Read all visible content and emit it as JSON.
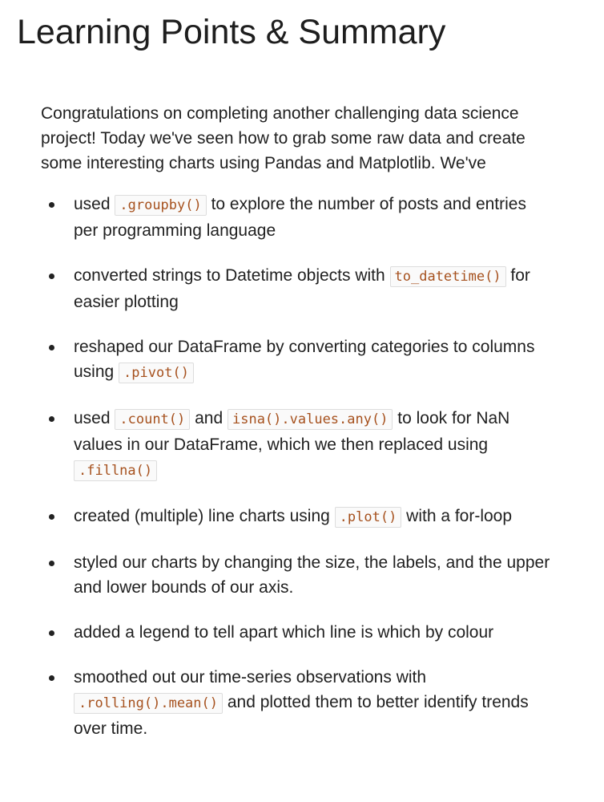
{
  "title": "Learning Points & Summary",
  "intro": "Congratulations on completing another challenging data science project! Today we've seen how to grab some raw data and create some interesting charts using Pandas and Matplotlib. We've",
  "bullets": [
    {
      "before": "used ",
      "code": ".groupby()",
      "after": " to explore the number of posts and entries per programming language"
    },
    {
      "before": "converted strings to Datetime objects with ",
      "code": "to_datetime()",
      "after": " for easier plotting"
    },
    {
      "before": "reshaped our DataFrame by converting categories to columns using ",
      "code": ".pivot()",
      "after": ""
    },
    {
      "before": "used ",
      "code": ".count()",
      "mid": " and ",
      "code2": "isna().values.any()",
      "mid2": " to look for NaN values in our DataFrame, which we then replaced using ",
      "code3": ".fillna()"
    },
    {
      "before": "created (multiple) line charts using ",
      "code": ".plot()",
      "after": " with a for-loop"
    },
    {
      "text": "styled our charts by changing the size, the labels, and the upper and lower bounds of our axis."
    },
    {
      "text": "added a legend to tell apart which line is which by colour"
    },
    {
      "before": "smoothed out our time-series observations with ",
      "code": ".rolling().mean()",
      "after": " and plotted them to better identify trends over time."
    }
  ]
}
